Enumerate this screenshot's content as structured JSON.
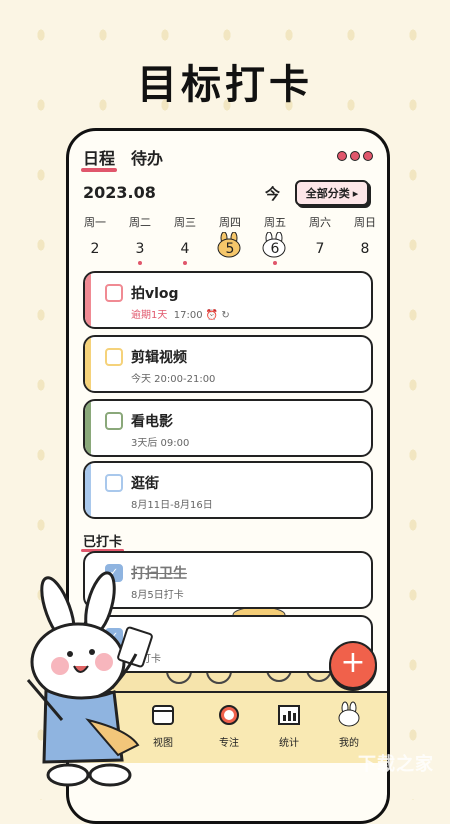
{
  "headline": "目标打卡",
  "tabs": {
    "schedule": "日程",
    "todo": "待办"
  },
  "month": "2023.08",
  "today_label": "今",
  "filter_label": "全部分类",
  "filter_arrow": "▸",
  "week": [
    {
      "dow": "周一",
      "num": "2",
      "dot": false
    },
    {
      "dow": "周二",
      "num": "3",
      "dot": true
    },
    {
      "dow": "周三",
      "num": "4",
      "dot": true
    },
    {
      "dow": "周四",
      "num": "5",
      "dot": false,
      "selected": true
    },
    {
      "dow": "周五",
      "num": "6",
      "dot": true,
      "today": true
    },
    {
      "dow": "周六",
      "num": "7",
      "dot": false
    },
    {
      "dow": "周日",
      "num": "8",
      "dot": false
    }
  ],
  "tasks": [
    {
      "title": "拍vlog",
      "overdue": "逾期1天",
      "time": "17:00",
      "color": "#f08a93"
    },
    {
      "title": "剪辑视频",
      "time": "今天 20:00-21:00",
      "color": "#f5d27a"
    },
    {
      "title": "看电影",
      "time": "3天后 09:00",
      "color": "#8aa87a"
    },
    {
      "title": "逛街",
      "time": "8月11日-8月16日",
      "color": "#a9c8ec"
    }
  ],
  "done_section": "已打卡",
  "done_tasks": [
    {
      "title": "打扫卫生",
      "time": "8月5日打卡"
    },
    {
      "title": "",
      "time": "日打卡"
    }
  ],
  "fab_label": "+",
  "nav": [
    {
      "label": "视图",
      "icon": "calendar-icon"
    },
    {
      "label": "专注",
      "icon": "alarm-clock-icon"
    },
    {
      "label": "统计",
      "icon": "chart-icon"
    },
    {
      "label": "我的",
      "icon": "bunny-icon"
    }
  ],
  "watermark": "下载之家"
}
